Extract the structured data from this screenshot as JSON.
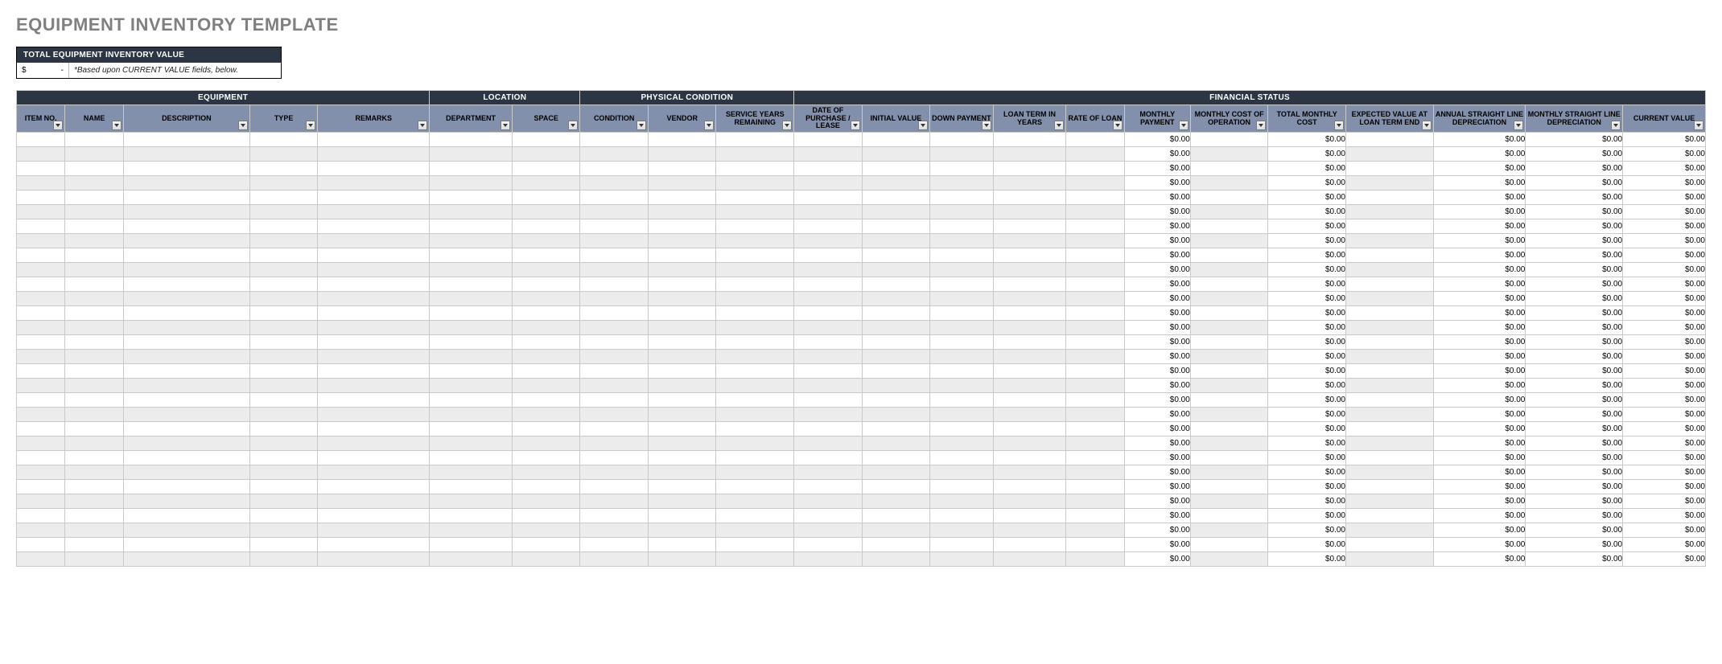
{
  "title": "EQUIPMENT INVENTORY TEMPLATE",
  "summary": {
    "header": "TOTAL EQUIPMENT INVENTORY VALUE",
    "currency_symbol": "$",
    "value_dash": "-",
    "note": "*Based upon CURRENT VALUE fields, below."
  },
  "groups": [
    {
      "label": "EQUIPMENT",
      "span": 5
    },
    {
      "label": "LOCATION",
      "span": 2
    },
    {
      "label": "PHYSICAL CONDITION",
      "span": 3
    },
    {
      "label": "FINANCIAL STATUS",
      "span": 12
    }
  ],
  "columns": [
    "ITEM NO.",
    "NAME",
    "DESCRIPTION",
    "TYPE",
    "REMARKS",
    "DEPARTMENT",
    "SPACE",
    "CONDITION",
    "VENDOR",
    "SERVICE YEARS REMAINING",
    "DATE OF PURCHASE / LEASE",
    "INITIAL VALUE",
    "DOWN PAYMENT",
    "LOAN TERM IN YEARS",
    "RATE OF LOAN",
    "MONTHLY PAYMENT",
    "MONTHLY COST OF OPERATION",
    "TOTAL MONTHLY COST",
    "EXPECTED VALUE AT LOAN TERM END",
    "ANNUAL STRAIGHT LINE DEPRECIATION",
    "MONTHLY STRAIGHT LINE DEPRECIATION",
    "CURRENT VALUE"
  ],
  "row_count": 30,
  "zero_money": "$0.00",
  "money_columns": [
    15,
    17,
    19,
    20,
    21
  ]
}
